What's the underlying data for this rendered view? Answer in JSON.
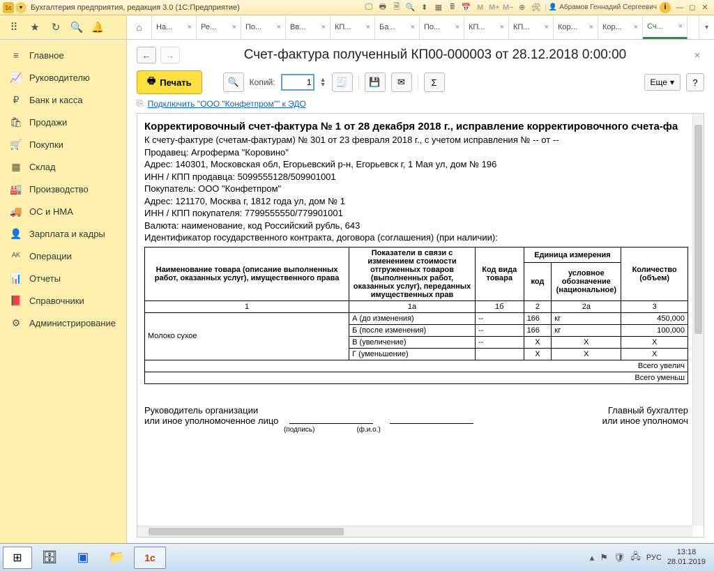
{
  "titlebar": {
    "app_title": "Бухгалтерия предприятия, редакция 3.0  (1С:Предприятие)",
    "user": "Абрамов Геннадий Сергеевич"
  },
  "tabs": [
    {
      "label": "На..."
    },
    {
      "label": "Ре..."
    },
    {
      "label": "По..."
    },
    {
      "label": "Вв..."
    },
    {
      "label": "КП..."
    },
    {
      "label": "Ба..."
    },
    {
      "label": "По..."
    },
    {
      "label": "КП..."
    },
    {
      "label": "КП..."
    },
    {
      "label": "Кор..."
    },
    {
      "label": "Кор..."
    },
    {
      "label": "Сч...",
      "active": true
    }
  ],
  "sidebar": {
    "items": [
      {
        "icon": "≡",
        "label": "Главное"
      },
      {
        "icon": "📈",
        "label": "Руководителю"
      },
      {
        "icon": "₽",
        "label": "Банк и касса"
      },
      {
        "icon": "🛍",
        "label": "Продажи"
      },
      {
        "icon": "🛒",
        "label": "Покупки"
      },
      {
        "icon": "▦",
        "label": "Склад"
      },
      {
        "icon": "🏭",
        "label": "Производство"
      },
      {
        "icon": "🚚",
        "label": "ОС и НМА"
      },
      {
        "icon": "👤",
        "label": "Зарплата и кадры"
      },
      {
        "icon": "ᴬᴷ",
        "label": "Операции"
      },
      {
        "icon": "📊",
        "label": "Отчеты"
      },
      {
        "icon": "📕",
        "label": "Справочники"
      },
      {
        "icon": "⚙",
        "label": "Администрирование"
      }
    ]
  },
  "content": {
    "title": "Счет-фактура полученный КП00-000003 от 28.12.2018 0:00:00",
    "print_label": "Печать",
    "copies_label": "Копий:",
    "copies_value": "1",
    "more_label": "Еще",
    "edo_link": "Подключить \"ООО \"Конфетпром\"\" к ЭДО"
  },
  "document": {
    "heading": "Корректировочный счет-фактура № 1 от 28 декабря 2018 г., исправление корректировочного счета-фа",
    "lines": [
      "К счету-фактуре (счетам-фактурам) № 301 от 23 февраля 2018 г., с учетом исправления № -- от --",
      "Продавец: Агроферма \"Коровино\"",
      "Адрес: 140301, Московская обл, Егорьевский р-н, Егорьевск г, 1 Мая ул, дом № 196",
      "ИНН / КПП продавца: 5099555128/509901001",
      "Покупатель: ООО \"Конфетпром\"",
      "Адрес: 121170, Москва г, 1812 года ул, дом № 1",
      "ИНН / КПП покупателя: 7799555550/779901001",
      "Валюта: наименование, код Российский рубль, 643",
      "Идентификатор государственного контракта, договора (соглашения) (при наличии):"
    ],
    "table": {
      "headers": {
        "name": "Наименование товара (описание выполненных работ, оказанных услуг), имущественного права",
        "indicators": "Показатели в связи с изменением стоимости отгруженных товаров (выполненных работ, оказанных услуг), переданных имущественных прав",
        "code": "Код вида товара",
        "unit": "Единица измерения",
        "unit_code": "код",
        "unit_name": "условное обозначение (национальное)",
        "qty": "Количество (объем)"
      },
      "colnums": [
        "1",
        "1а",
        "1б",
        "2",
        "2а",
        "3"
      ],
      "rows": [
        {
          "name": "Молоко сухое",
          "ind": "А (до изменения)",
          "code": "--",
          "uc": "166",
          "un": "кг",
          "qty": "450,000"
        },
        {
          "name": "",
          "ind": "Б (после изменения)",
          "code": "--",
          "uc": "166",
          "un": "кг",
          "qty": "100,000"
        },
        {
          "name": "",
          "ind": "В (увеличение)",
          "code": "--",
          "uc": "Х",
          "un": "Х",
          "qty": "Х"
        },
        {
          "name": "",
          "ind": "Г (уменьшение)",
          "code": "",
          "uc": "Х",
          "un": "Х",
          "qty": "Х"
        }
      ],
      "totals": [
        "Всего увелич",
        "Всего уменьш"
      ]
    },
    "signatures": {
      "left1": "Руководитель организации",
      "left2": "или иное уполномоченное лицо",
      "right1": "Главный бухгалтер",
      "right2": "или иное уполномоч",
      "sub_sign": "(подпись)",
      "sub_fio": "(ф.и.о.)"
    }
  },
  "taskbar": {
    "lang": "РУС",
    "time": "13:18",
    "date": "28.01.2019"
  }
}
